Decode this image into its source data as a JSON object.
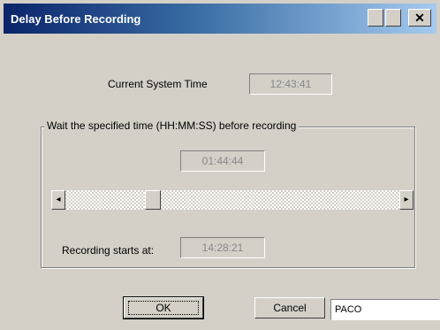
{
  "window": {
    "title": "Delay Before Recording",
    "close_glyph": "✕"
  },
  "current_time": {
    "label": "Current System Time",
    "value": "12:43:41"
  },
  "group": {
    "title": "Wait the specified time (HH:MM:SS) before recording"
  },
  "wait_time": {
    "value": "01:44:44"
  },
  "scrollbar": {
    "left_arrow": "◂",
    "right_arrow": "▸",
    "position_percent": 25
  },
  "recording_starts": {
    "label": "Recording starts at:",
    "value": "14:28:21"
  },
  "buttons": {
    "ok": "OK",
    "cancel": "Cancel"
  },
  "status": {
    "text": "PACO"
  },
  "colors": {
    "face": "#d4d0c8",
    "title_start": "#0a246a",
    "title_end": "#a6caf0"
  }
}
